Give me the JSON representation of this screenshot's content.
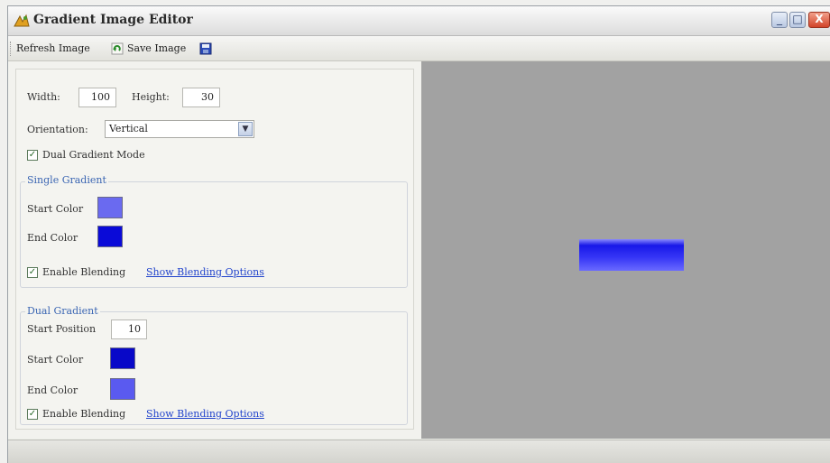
{
  "window": {
    "title": "Gradient Image Editor",
    "controls": {
      "minimize": "_",
      "maximize": "□",
      "close": "X"
    }
  },
  "toolbar": {
    "refresh_label": "Refresh Image",
    "save_label": "Save Image"
  },
  "form": {
    "width_label": "Width:",
    "width_value": "100",
    "height_label": "Height:",
    "height_value": "30",
    "orientation_label": "Orientation:",
    "orientation_value": "Vertical",
    "dual_mode_label": "Dual Gradient Mode",
    "dual_mode_checked": true
  },
  "single_gradient": {
    "title": "Single Gradient",
    "start_color_label": "Start Color",
    "start_color": "#6a6af0",
    "end_color_label": "End Color",
    "end_color": "#0a0ad8",
    "enable_blending_label": "Enable Blending",
    "show_blending_link": "Show Blending Options"
  },
  "dual_gradient": {
    "title": "Dual Gradient",
    "start_position_label": "Start Position",
    "start_position_value": "10",
    "start_color_label": "Start Color",
    "start_color": "#0808c8",
    "end_color_label": "End Color",
    "end_color": "#5a5af0",
    "enable_blending_label": "Enable Blending",
    "show_blending_link": "Show Blending Options"
  },
  "icons": {
    "app": "gradient-app-icon",
    "refresh": "refresh-icon",
    "save": "floppy-disk-icon"
  }
}
